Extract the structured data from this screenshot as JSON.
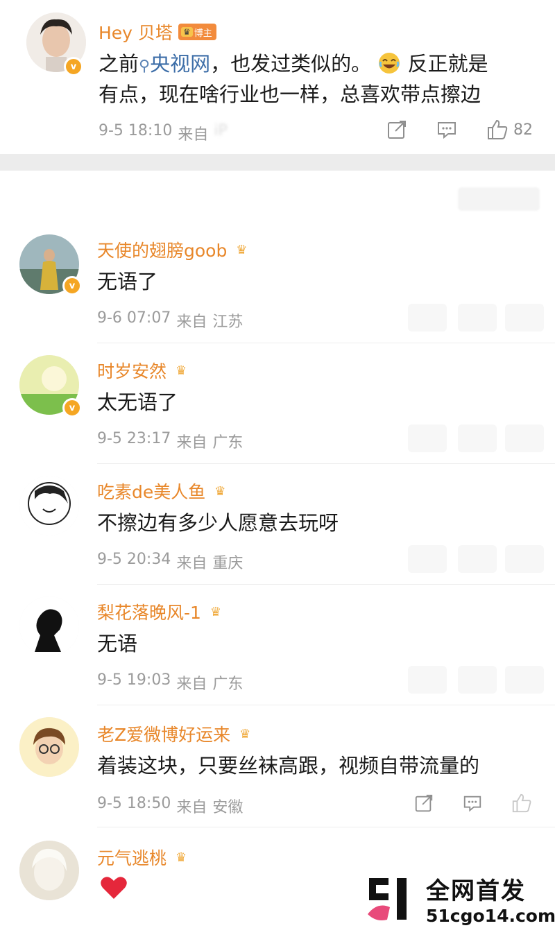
{
  "top_comment": {
    "name": "Hey 贝塔",
    "badge_label": "博主",
    "text_line1_a": "之前",
    "text_search_term": "央视网",
    "text_line1_b": "，也发过类似的。",
    "text_line1_c": "反正就是",
    "text_line2": "有点，现在啥行业也一样，总喜欢带点擦边",
    "time": "9-5 18:10",
    "source_prefix": "来自",
    "source_blurred": "iP",
    "like_count": "82"
  },
  "comments": [
    {
      "name": "天使的翅膀goob",
      "text": "无语了",
      "time": "9-6 07:07",
      "source_prefix": "来自",
      "location": "江苏",
      "verified": true
    },
    {
      "name": "时岁安然",
      "text": "太无语了",
      "time": "9-5 23:17",
      "source_prefix": "来自",
      "location": "广东",
      "verified": true
    },
    {
      "name": "吃素de美人鱼",
      "text": "不擦边有多少人愿意去玩呀",
      "time": "9-5 20:34",
      "source_prefix": "来自",
      "location": "重庆",
      "verified": false
    },
    {
      "name": "梨花落晚风-1",
      "text": "无语",
      "time": "9-5 19:03",
      "source_prefix": "来自",
      "location": "广东",
      "verified": false
    },
    {
      "name": "老Z爱微博好运来",
      "text": "着装这块，只要丝袜高跟，视频自带流量的",
      "time": "9-5 18:50",
      "source_prefix": "来自",
      "location": "安徽",
      "verified": false
    },
    {
      "name": "元气逃桃",
      "text": "",
      "time": "",
      "source_prefix": "",
      "location": "",
      "verified": false
    }
  ],
  "watermark": {
    "line1": "全网首发",
    "line2": "51cgo14.com"
  },
  "colors": {
    "name": "#e8872a",
    "meta": "#9b9b9b",
    "heart": "#e5273b",
    "verified": "#f5a623"
  }
}
